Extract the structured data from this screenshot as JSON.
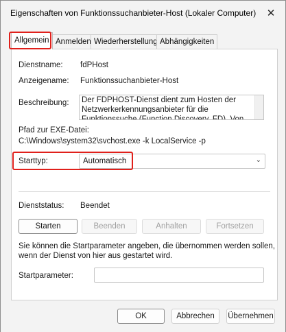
{
  "window": {
    "title": "Eigenschaften von Funktionssuchanbieter-Host (Lokaler Computer)",
    "close_glyph": "✕"
  },
  "tabs": [
    {
      "label": "Allgemein",
      "active": true
    },
    {
      "label": "Anmelden",
      "active": false
    },
    {
      "label": "Wiederherstellung",
      "active": false
    },
    {
      "label": "Abhängigkeiten",
      "active": false
    }
  ],
  "general": {
    "service_name_label": "Dienstname:",
    "service_name_value": "fdPHost",
    "display_name_label": "Anzeigename:",
    "display_name_value": "Funktionssuchanbieter-Host",
    "description_label": "Beschreibung:",
    "description_lines": [
      "Der FDPHOST-Dienst dient zum Hosten der",
      "Netzwerkerkennungsanbieter für die",
      "Funktionssuche (Function Discovery, FD). Von"
    ],
    "exe_path_label": "Pfad zur EXE-Datei:",
    "exe_path_value": "C:\\Windows\\system32\\svchost.exe -k LocalService -p",
    "startup_type_label": "Starttyp:",
    "startup_type_value": "Automatisch",
    "service_status_label": "Dienststatus:",
    "service_status_value": "Beendet",
    "buttons": {
      "start": "Starten",
      "stop": "Beenden",
      "pause": "Anhalten",
      "resume": "Fortsetzen"
    },
    "info_text_line1": "Sie können die Startparameter angeben, die übernommen werden sollen,",
    "info_text_line2": "wenn der Dienst von hier aus gestartet wird.",
    "start_params_label": "Startparameter:",
    "start_params_value": ""
  },
  "footer": {
    "ok": "OK",
    "cancel": "Abbrechen",
    "apply": "Übernehmen"
  },
  "colors": {
    "highlight": "#e0201b"
  }
}
